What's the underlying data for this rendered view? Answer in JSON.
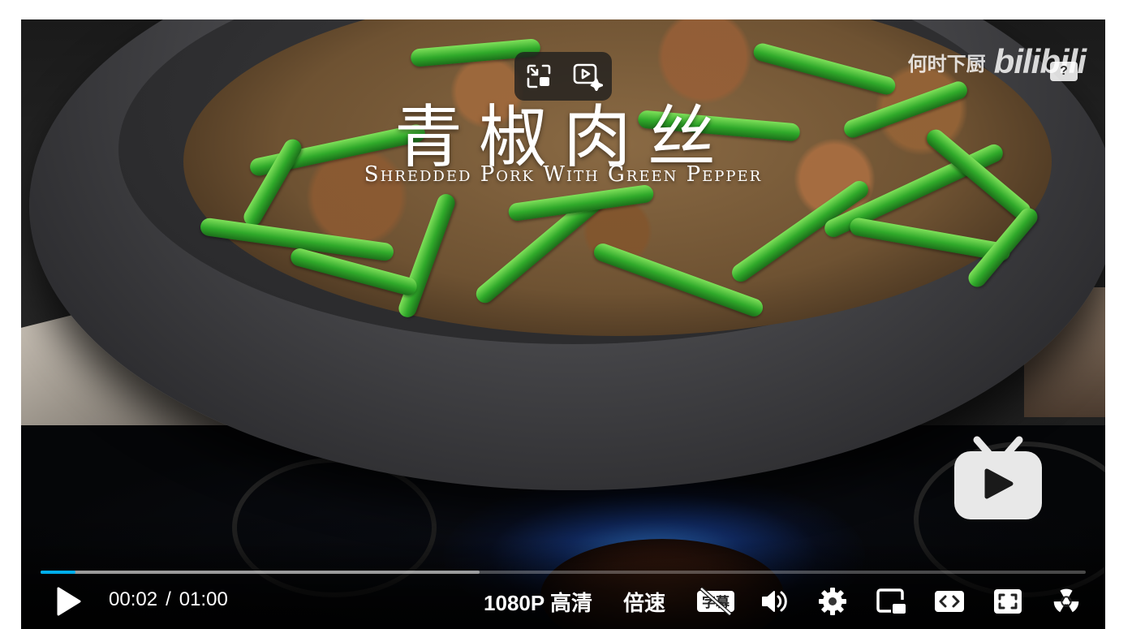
{
  "video": {
    "title_cn": "青椒肉丝",
    "title_en": "Shredded Pork With Green Pepper",
    "watermark_channel": "何时下厨",
    "watermark_logo": "bilibili",
    "watermark_logo_mark": "?"
  },
  "float_controls": {
    "items": [
      {
        "icon": "picture-in-picture-exit-icon"
      },
      {
        "icon": "ai-play-icon"
      }
    ]
  },
  "player": {
    "progress_played": 0.033,
    "progress_buffered": 0.42,
    "current_time": "00:02",
    "time_separator": "/",
    "duration": "01:00",
    "quality": "1080P 高清",
    "speed": "倍速",
    "subtitle_label": "字幕",
    "accent_color": "#00aeec"
  }
}
